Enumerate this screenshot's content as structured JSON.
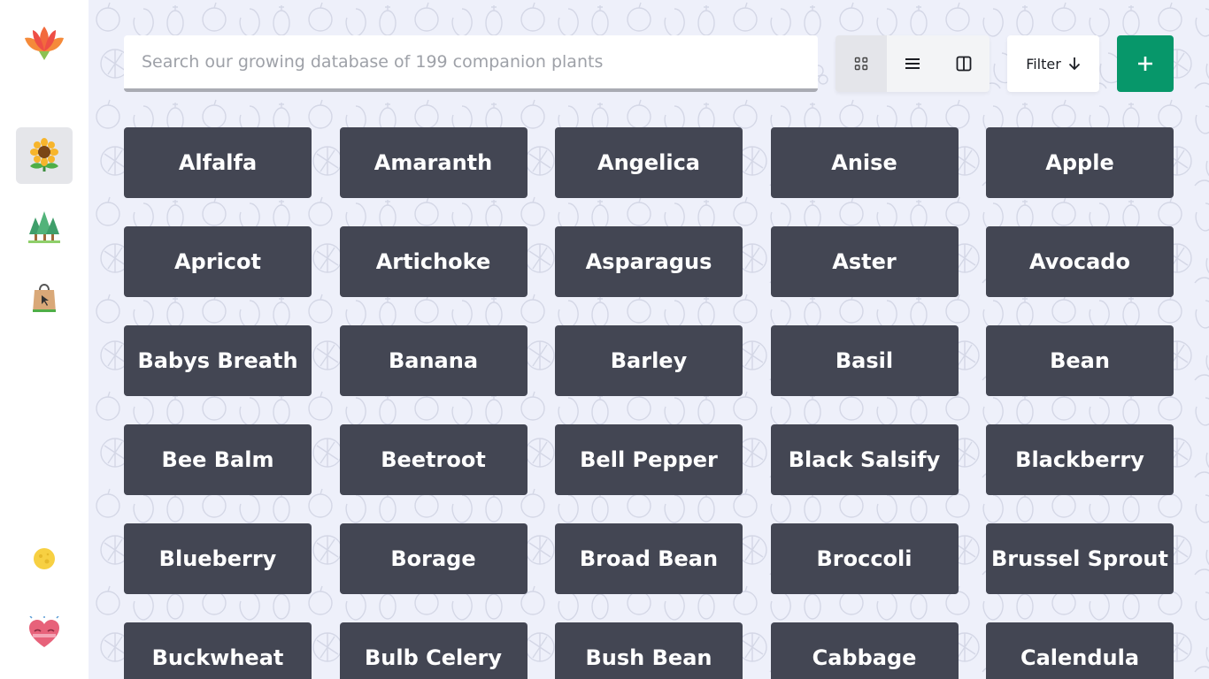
{
  "app": {
    "logo_icon": "lotus-logo-icon"
  },
  "sidebar": {
    "items": [
      {
        "name": "plants",
        "icon": "sunflower-icon",
        "active": true
      },
      {
        "name": "gardens",
        "icon": "trees-icon",
        "active": false
      },
      {
        "name": "shop",
        "icon": "shopping-bag-icon",
        "active": false
      },
      {
        "name": "theme",
        "icon": "moon-icon",
        "active": false
      },
      {
        "name": "favorites",
        "icon": "heart-icon",
        "active": false
      }
    ]
  },
  "search": {
    "placeholder": "Search our growing database of 199 companion plants",
    "value": ""
  },
  "view_toggle": {
    "options": [
      {
        "name": "grid",
        "icon": "grid-icon",
        "active": true
      },
      {
        "name": "list",
        "icon": "list-icon",
        "active": false
      },
      {
        "name": "columns",
        "icon": "columns-icon",
        "active": false
      }
    ]
  },
  "filter": {
    "label": "Filter",
    "icon": "arrow-down-icon"
  },
  "add_button": {
    "icon": "plus-icon"
  },
  "plants": [
    "Alfalfa",
    "Amaranth",
    "Angelica",
    "Anise",
    "Apple",
    "Apricot",
    "Artichoke",
    "Asparagus",
    "Aster",
    "Avocado",
    "Babys Breath",
    "Banana",
    "Barley",
    "Basil",
    "Bean",
    "Bee Balm",
    "Beetroot",
    "Bell Pepper",
    "Black Salsify",
    "Blackberry",
    "Blueberry",
    "Borage",
    "Broad Bean",
    "Broccoli",
    "Brussel Sprout",
    "Buckwheat",
    "Bulb Celery",
    "Bush Bean",
    "Cabbage",
    "Calendula"
  ],
  "colors": {
    "card_bg": "#434653",
    "accent_green": "#07976a",
    "page_bg": "#eef0fa"
  }
}
